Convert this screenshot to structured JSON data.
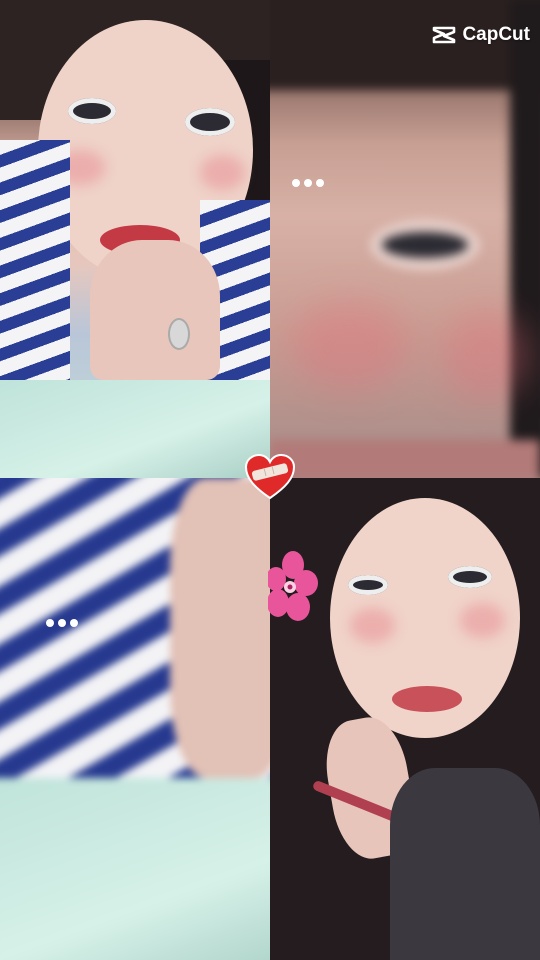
{
  "brand": {
    "name": "CapCut",
    "icon": "capcut-logo-icon",
    "color": "#ffffff"
  },
  "panels": [
    {
      "id": "top-left",
      "description_icon": "selfie-photo"
    },
    {
      "id": "top-right",
      "description_icon": "zoomed-face-photo"
    },
    {
      "id": "bottom-left",
      "description_icon": "zoomed-shirt-photo"
    },
    {
      "id": "bottom-right",
      "description_icon": "portrait-photo"
    }
  ],
  "overlays": {
    "more_dots_icon": "more-dots-icon",
    "heart_sticker_icon": "bandaged-heart-icon",
    "flower_sticker_icon": "pink-flower-icon"
  },
  "colors": {
    "stripe_blue": "#2a3e96",
    "heart_red": "#e02a2a",
    "flower_pink": "#e8559a"
  }
}
